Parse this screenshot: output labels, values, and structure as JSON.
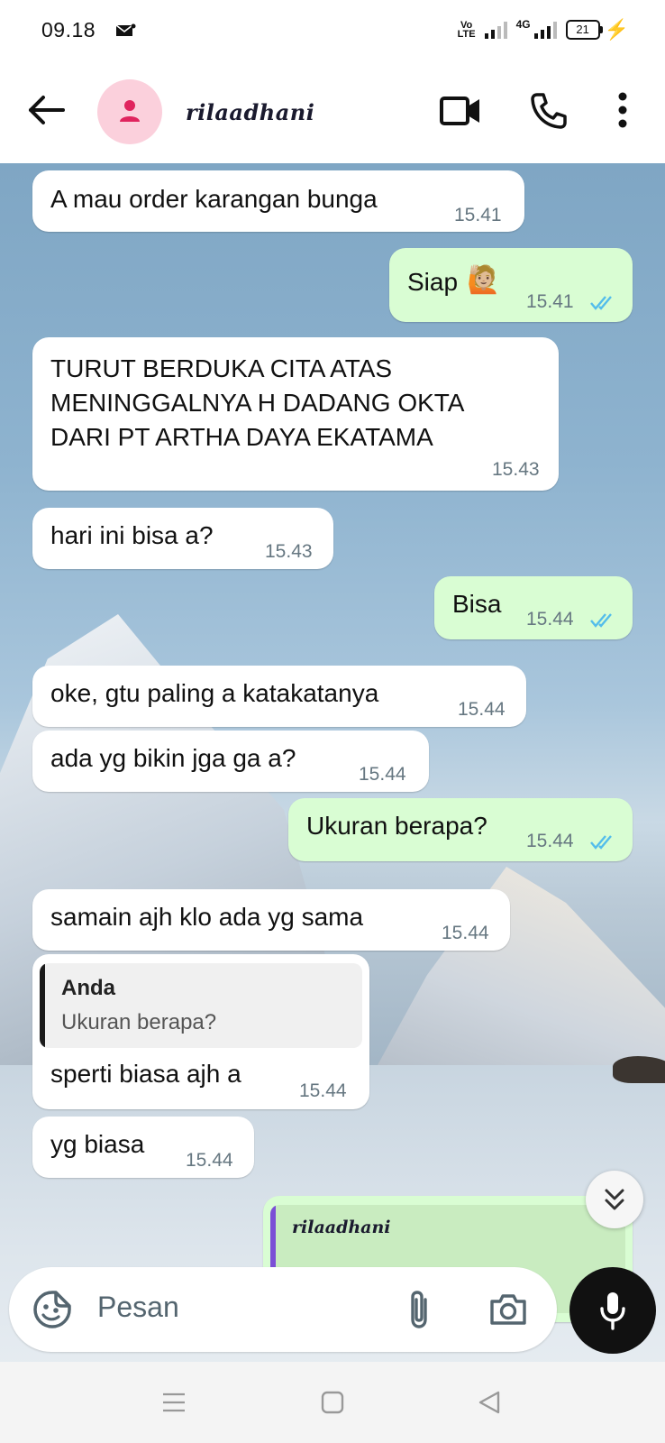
{
  "status_bar": {
    "time": "09.18",
    "volte_top": "Vo",
    "volte_bottom": "LTE",
    "network": "4G",
    "battery": "21"
  },
  "header": {
    "contact_name": "rilaadhani",
    "icons": [
      "back-arrow-icon",
      "avatar-person-icon",
      "video-call-icon",
      "voice-call-icon",
      "more-options-icon"
    ]
  },
  "messages": [
    {
      "dir": "in",
      "text": "A mau order karangan bunga",
      "time": "15.41"
    },
    {
      "dir": "out",
      "text": "Siap",
      "emoji": "🙋🏼",
      "time": "15.41",
      "read": true
    },
    {
      "dir": "in",
      "lines": [
        "TURUT BERDUKA CITA ATAS",
        "MENINGGALNYA H DADANG OKTA",
        "DARI PT ARTHA DAYA EKATAMA"
      ],
      "time": "15.43"
    },
    {
      "dir": "in",
      "text": "hari ini bisa a?",
      "time": "15.43"
    },
    {
      "dir": "out",
      "text": "Bisa",
      "time": "15.44",
      "read": true
    },
    {
      "dir": "in",
      "text": "oke, gtu paling a katakatanya",
      "time": "15.44"
    },
    {
      "dir": "in",
      "text": "ada yg bikin jga ga a?",
      "time": "15.44"
    },
    {
      "dir": "out",
      "text": "Ukuran berapa?",
      "time": "15.44",
      "read": true
    },
    {
      "dir": "in",
      "text": "samain ajh klo ada yg sama",
      "time": "15.44"
    },
    {
      "dir": "in",
      "quote_name": "Anda",
      "quote_text": "Ukuran berapa?",
      "text": "sperti biasa ajh a",
      "time": "15.44"
    },
    {
      "dir": "in",
      "text": "yg biasa",
      "time": "15.44"
    },
    {
      "dir": "out",
      "quote_name": "rilaadhani"
    }
  ],
  "input": {
    "placeholder": "Pesan"
  },
  "colors": {
    "incoming_bubble": "#ffffff",
    "outgoing_bubble": "#d9fdd3",
    "read_ticks": "#53bdeb",
    "avatar_bg": "#fbd0dc",
    "avatar_fg": "#e0245e",
    "quote_bar_contact": "#7b4fd6"
  }
}
